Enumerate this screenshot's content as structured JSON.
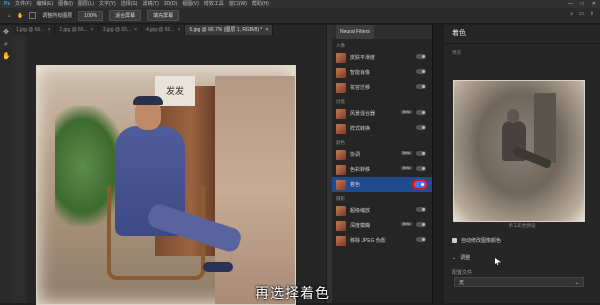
{
  "menubar": {
    "items": [
      "文件(F)",
      "编辑(E)",
      "图像(I)",
      "图层(L)",
      "文字(Y)",
      "选择(S)",
      "滤镜(T)",
      "3D(D)",
      "视图(V)",
      "增效工具",
      "窗口(W)",
      "帮助(H)"
    ],
    "window_controls": [
      "—",
      "□",
      "✕"
    ]
  },
  "options": {
    "checkbox_label": "调整所有图层",
    "zoom": "100%",
    "fit_label": "适合屏幕",
    "fill_label": "填充屏幕"
  },
  "doc_tabs": [
    {
      "label": "1.jpg @ 66..."
    },
    {
      "label": "2.jpg @ 66..."
    },
    {
      "label": "3.jpg @ 65..."
    },
    {
      "label": "4.jpg @ 66..."
    },
    {
      "label": "5.jpg @ 66.7% (图层 1, RGB/8) *"
    }
  ],
  "photo_sign": "发发",
  "neural_filters": {
    "tab": "Neural Filters",
    "sections": [
      {
        "title": "人像",
        "items": [
          {
            "label": "皮肤平滑度"
          },
          {
            "label": "智能肖像"
          },
          {
            "label": "妆容迁移"
          }
        ]
      },
      {
        "title": "创意",
        "items": [
          {
            "label": "风景混合器",
            "badge": "Beta"
          },
          {
            "label": "样式转换"
          }
        ]
      },
      {
        "title": "颜色",
        "items": [
          {
            "label": "协调",
            "badge": "Beta"
          },
          {
            "label": "色彩转移",
            "badge": "Beta"
          },
          {
            "label": "着色",
            "selected": true
          }
        ]
      },
      {
        "title": "摄影",
        "items": [
          {
            "label": "超级缩放"
          },
          {
            "label": "深度模糊",
            "badge": "Beta"
          },
          {
            "label": "移除 JPEG 伪影"
          }
        ]
      }
    ]
  },
  "colorize": {
    "title": "着色",
    "preview_label": "预览",
    "preview_hint": "手工彩色预设",
    "auto_color_label": "自动修改图像颜色",
    "adjust_label": "调整",
    "profile_label": "配置文件",
    "profile_value": "无"
  },
  "subtitle": "再选择着色"
}
